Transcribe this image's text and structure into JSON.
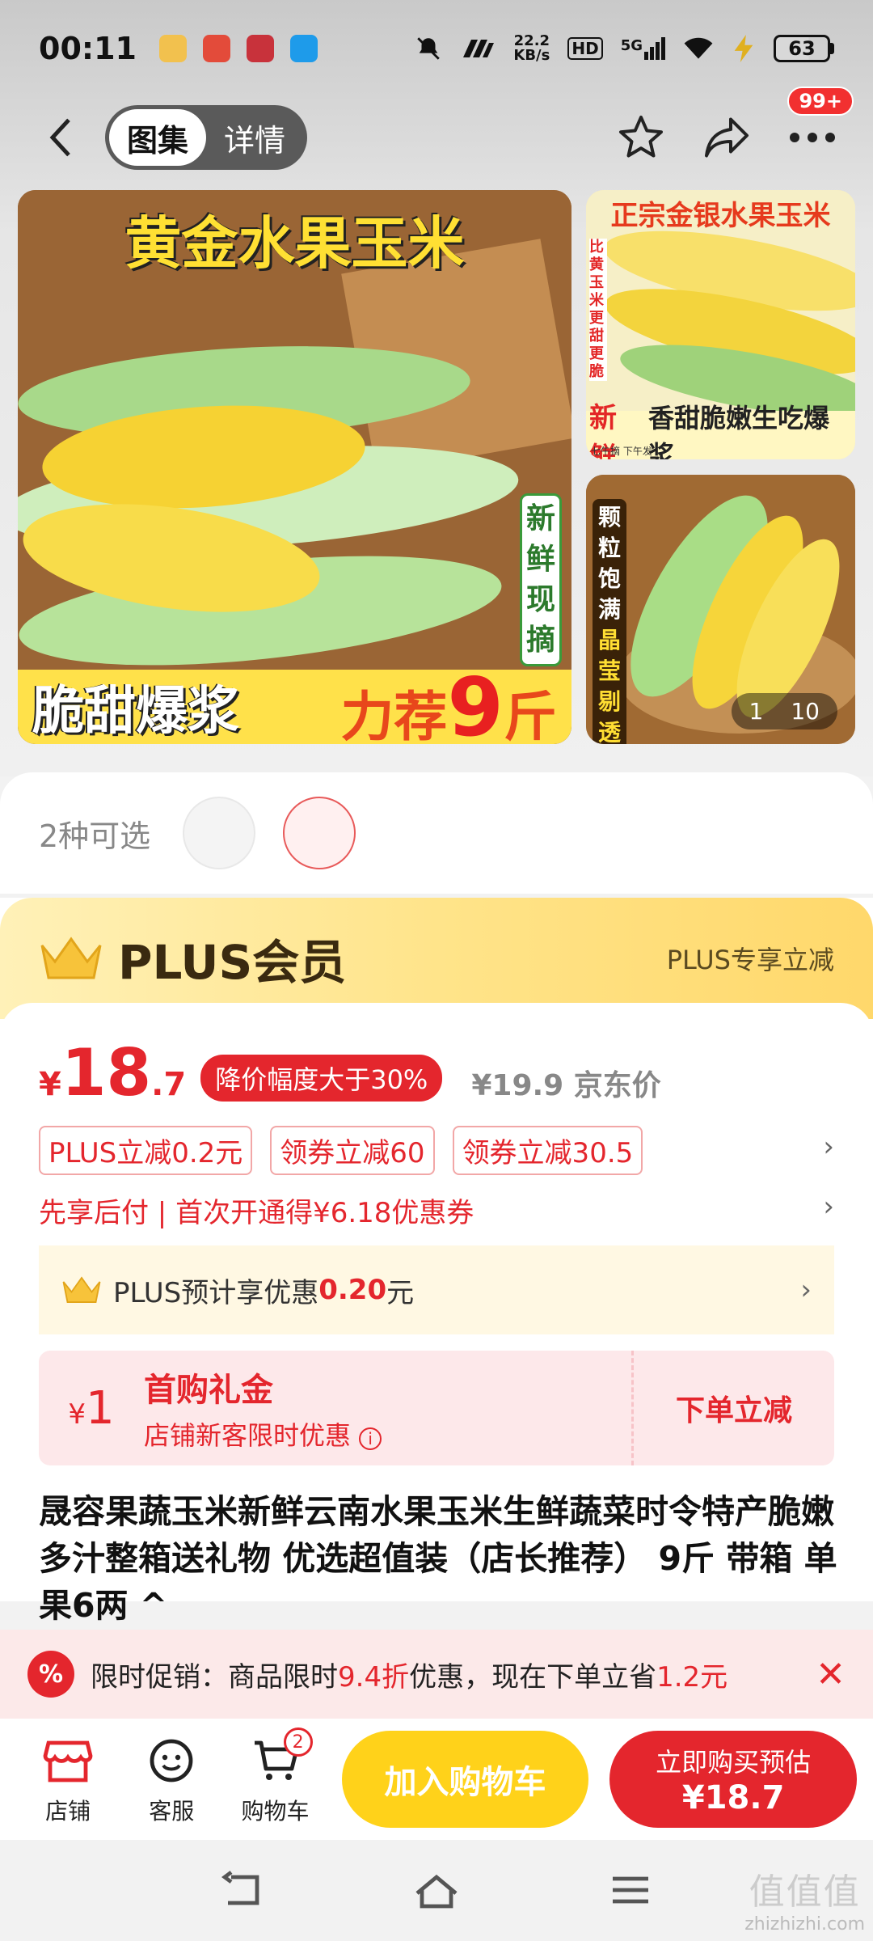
{
  "status": {
    "time": "00:11",
    "speed_top": "22.2",
    "speed_bottom": "KB/s",
    "hd": "HD",
    "signal": "5G",
    "battery": "63"
  },
  "header": {
    "tabs": [
      "图集",
      "详情"
    ],
    "active_tab": 0,
    "badge": "99+"
  },
  "gallery": {
    "main_title": "黄金水果玉米",
    "main_vertical": [
      "新",
      "鲜",
      "现",
      "摘"
    ],
    "main_bottom_left": "脆甜爆浆",
    "main_bottom_right_pre": "力荐",
    "main_bottom_right_num": "9",
    "main_bottom_right_unit": "斤",
    "side1_title": "正宗金银水果玉米",
    "side1_vertical": "比黄玉米更甜更脆",
    "side1_bottom_red": "新鲜",
    "side1_bottom_small": "七午摘 下午发",
    "side1_bottom_text": "香甜脆嫩生吃爆浆",
    "side2_vertical_white": [
      "颗",
      "粒",
      "饱",
      "满"
    ],
    "side2_vertical_yellow": [
      "晶",
      "莹",
      "剔",
      "透"
    ],
    "pager_current": "1",
    "pager_total": "10"
  },
  "variants": {
    "label": "2种可选",
    "count": 2
  },
  "plus": {
    "title": "PLUS会员",
    "right_text": "PLUS专享立减"
  },
  "price": {
    "yen": "¥",
    "int": "18",
    "dec": ".7",
    "drop_tag": "降价幅度大于30%",
    "jd_price": "¥19.9 京东价",
    "coupons": [
      "PLUS立减0.2元",
      "领券立减60",
      "领券立减30.5"
    ],
    "paylater": "先享后付 | 首次开通得¥6.18优惠券",
    "plus_save_pre": "PLUS预计享优惠",
    "plus_save_amt": "0.20",
    "plus_save_unit": "元"
  },
  "gift": {
    "yen": "¥",
    "amount": "1",
    "title": "首购礼金",
    "subtitle": "店铺新客限时优惠",
    "action": "下单立减"
  },
  "product": {
    "title": "晟容果蔬玉米新鲜云南水果玉米生鲜蔬菜时令特产脆嫩多汁整箱送礼物 优选超值装（店长推荐） 9斤 带箱 单果6两 ^"
  },
  "promo": {
    "icon": "%",
    "pre": "限时促销：商品限时",
    "discount": "9.4折",
    "mid": "优惠，现在下单立省",
    "save": "1.2元",
    "close": "✕"
  },
  "bottombar": {
    "shop": "店铺",
    "service": "客服",
    "cart": "购物车",
    "cart_count": "2",
    "add_cart": "加入购物车",
    "buy_line1": "立即购买预估",
    "buy_line2": "¥18.7"
  },
  "watermark": {
    "text1": "值值值",
    "text2": "zhizhizhi.com"
  }
}
